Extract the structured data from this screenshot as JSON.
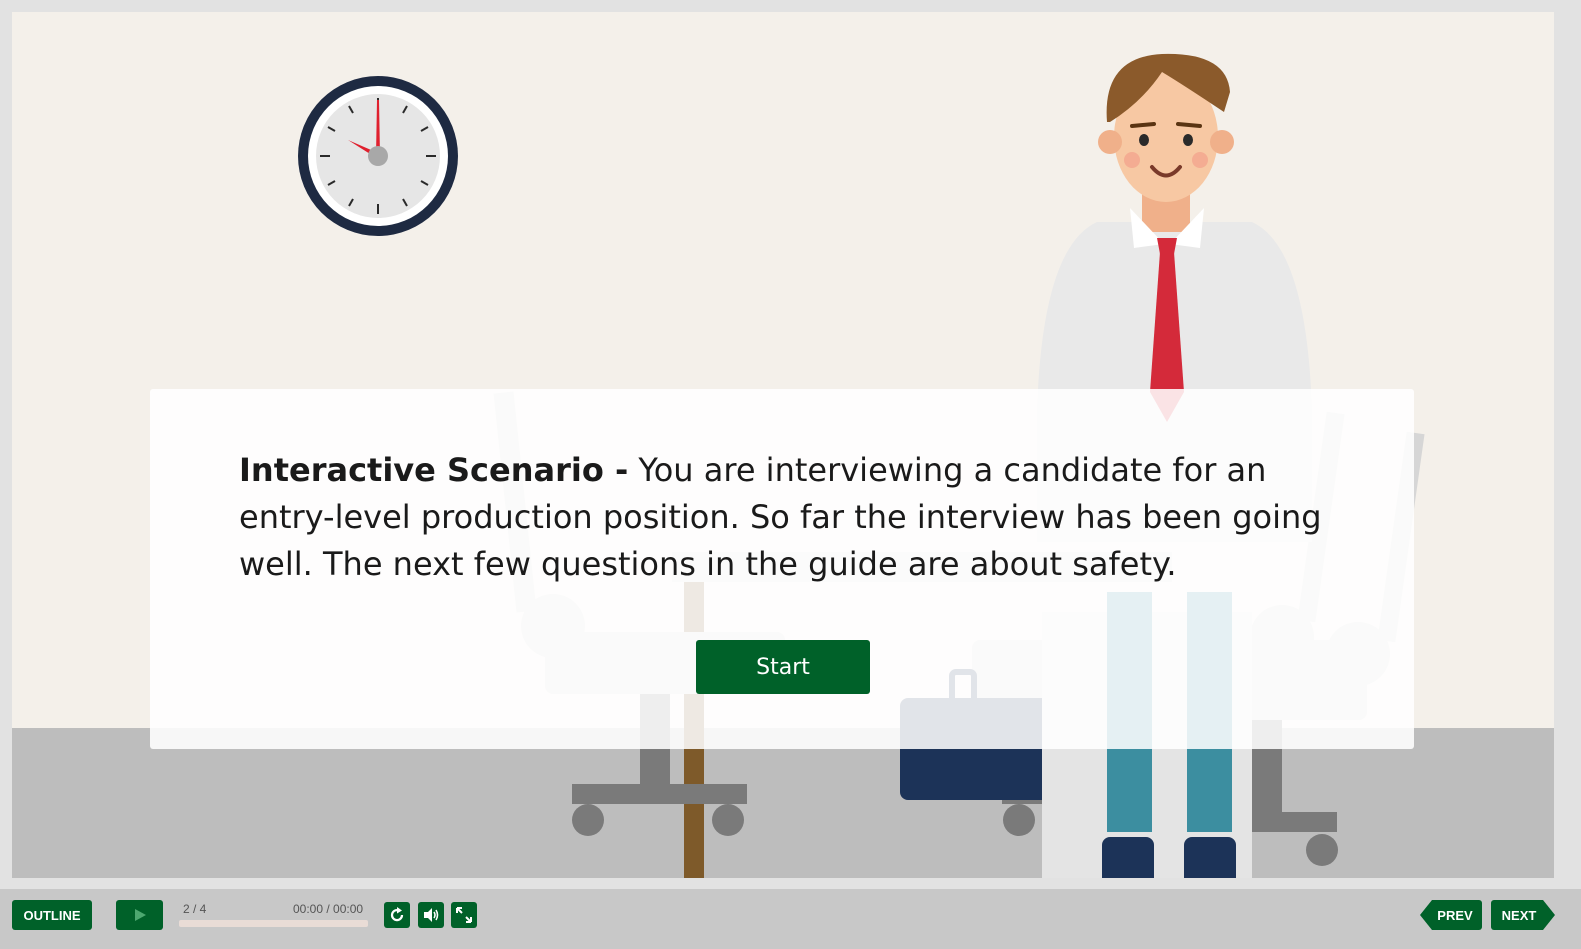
{
  "scenario": {
    "title": "Interactive Scenario -",
    "body": " You are interviewing a candidate for an entry-level production position.  So far the interview has been going well.  The next few questions in the guide are about safety."
  },
  "start_button": {
    "label": "Start"
  },
  "toolbar": {
    "outline_label": "OUTLINE",
    "slide_counter": "2 / 4",
    "time": "00:00 / 00:00",
    "prev_label": "PREV",
    "next_label": "NEXT",
    "progress": 0
  },
  "icons": [
    "clock-icon",
    "play-icon",
    "replay-icon",
    "volume-icon",
    "fullscreen-icon"
  ],
  "colors": {
    "accent": "#006129",
    "background": "#f4f0ea",
    "floor": "#bdbdbd",
    "tie": "#d42a3a"
  }
}
